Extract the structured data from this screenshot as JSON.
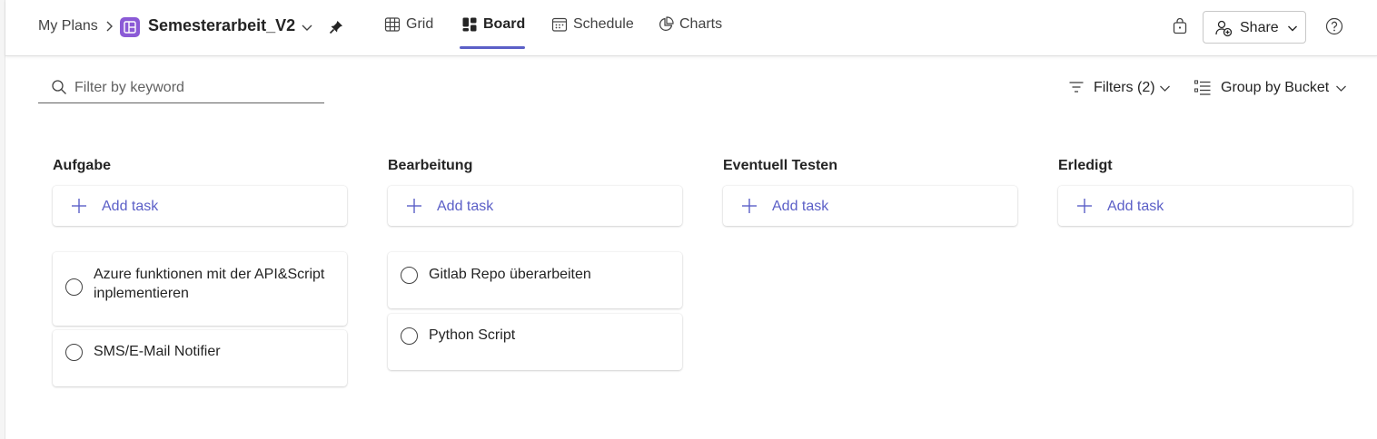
{
  "header": {
    "breadcrumb_root": "My Plans",
    "plan_title": "Semesterarbeit_V2",
    "tabs": [
      {
        "label": "Grid",
        "icon": "grid-icon",
        "active": false
      },
      {
        "label": "Board",
        "icon": "board-icon",
        "active": true
      },
      {
        "label": "Schedule",
        "icon": "calendar-icon",
        "active": false
      },
      {
        "label": "Charts",
        "icon": "chart-icon",
        "active": false
      }
    ],
    "share_label": "Share",
    "accent_color": "#5b5fc7",
    "plan_icon_color": "#8b5ad6"
  },
  "toolbar": {
    "filter_placeholder": "Filter by keyword",
    "filters_label": "Filters (2)",
    "group_label": "Group by Bucket"
  },
  "buckets": [
    {
      "title": "Aufgabe",
      "add_task_label": "Add task",
      "tasks": [
        {
          "title": "Azure funktionen mit der API&Script inplementieren"
        },
        {
          "title": "SMS/E-Mail Notifier"
        }
      ]
    },
    {
      "title": "Bearbeitung",
      "add_task_label": "Add task",
      "tasks": [
        {
          "title": "Gitlab Repo überarbeiten"
        },
        {
          "title": "Python Script"
        }
      ]
    },
    {
      "title": "Eventuell Testen",
      "add_task_label": "Add task",
      "tasks": []
    },
    {
      "title": "Erledigt",
      "add_task_label": "Add task",
      "tasks": []
    }
  ]
}
